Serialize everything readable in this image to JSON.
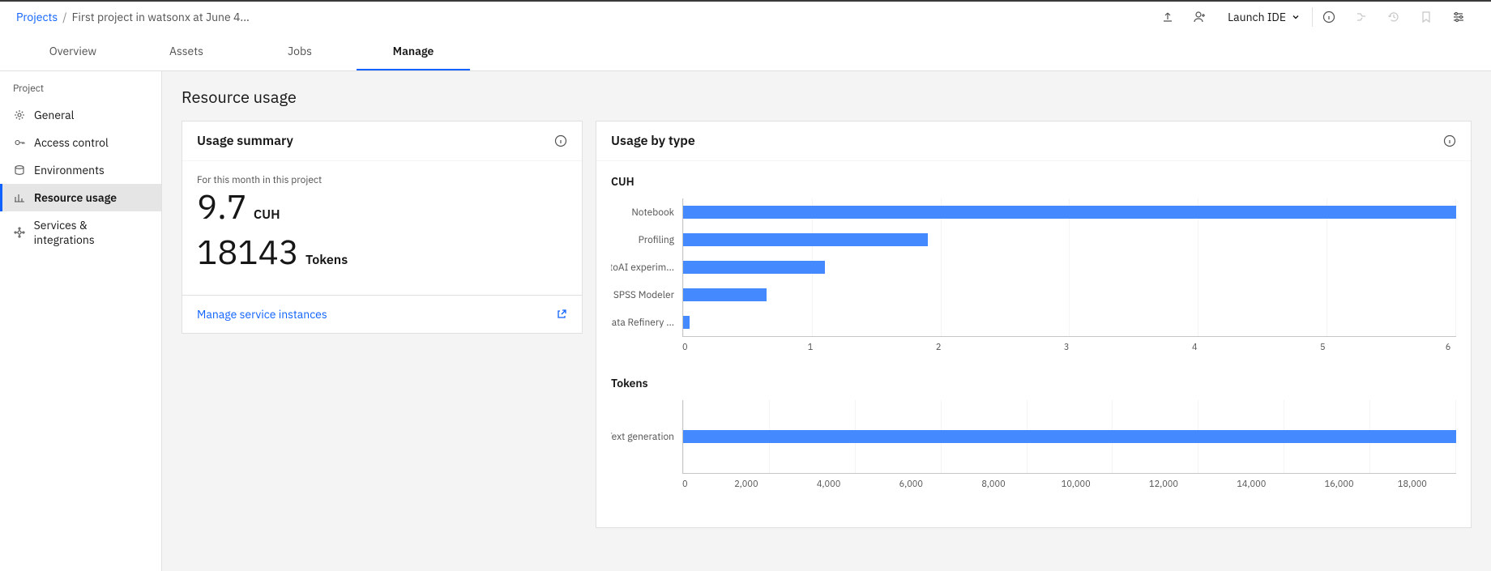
{
  "breadcrumb": {
    "root": "Projects",
    "current": "First project in watsonx at June 4..."
  },
  "topbar": {
    "launch_ide": "Launch IDE"
  },
  "tabs": {
    "overview": "Overview",
    "assets": "Assets",
    "jobs": "Jobs",
    "manage": "Manage"
  },
  "sidebar": {
    "section": "Project",
    "items": {
      "general": "General",
      "access": "Access control",
      "environments": "Environments",
      "resource": "Resource usage",
      "services": "Services & integrations"
    }
  },
  "page": {
    "title": "Resource usage"
  },
  "summary": {
    "header": "Usage summary",
    "subhead": "For this month in this project",
    "cuh_value": "9.7",
    "cuh_unit": "CUH",
    "tokens_value": "18143",
    "tokens_unit": "Tokens",
    "footer_link": "Manage service instances"
  },
  "usage_by_type": {
    "header": "Usage by type",
    "cuh_title": "CUH",
    "tokens_title": "Tokens"
  },
  "chart_data": [
    {
      "type": "bar",
      "orientation": "horizontal",
      "title": "CUH",
      "xlabel": "",
      "ylabel": "",
      "xlim": [
        0,
        6
      ],
      "ticks": [
        "0",
        "1",
        "2",
        "3",
        "4",
        "5",
        "6"
      ],
      "categories": [
        "Notebook",
        "Profiling",
        "AutoAI experim...",
        "SPSS Modeler",
        "Data Refinery ..."
      ],
      "values": [
        6.0,
        1.9,
        1.1,
        0.65,
        0.05
      ]
    },
    {
      "type": "bar",
      "orientation": "horizontal",
      "title": "Tokens",
      "xlabel": "",
      "ylabel": "",
      "xlim": [
        0,
        18000
      ],
      "ticks": [
        "0",
        "2,000",
        "4,000",
        "6,000",
        "8,000",
        "10,000",
        "12,000",
        "14,000",
        "16,000",
        "18,000"
      ],
      "categories": [
        "Text generation"
      ],
      "values": [
        18000
      ]
    }
  ]
}
